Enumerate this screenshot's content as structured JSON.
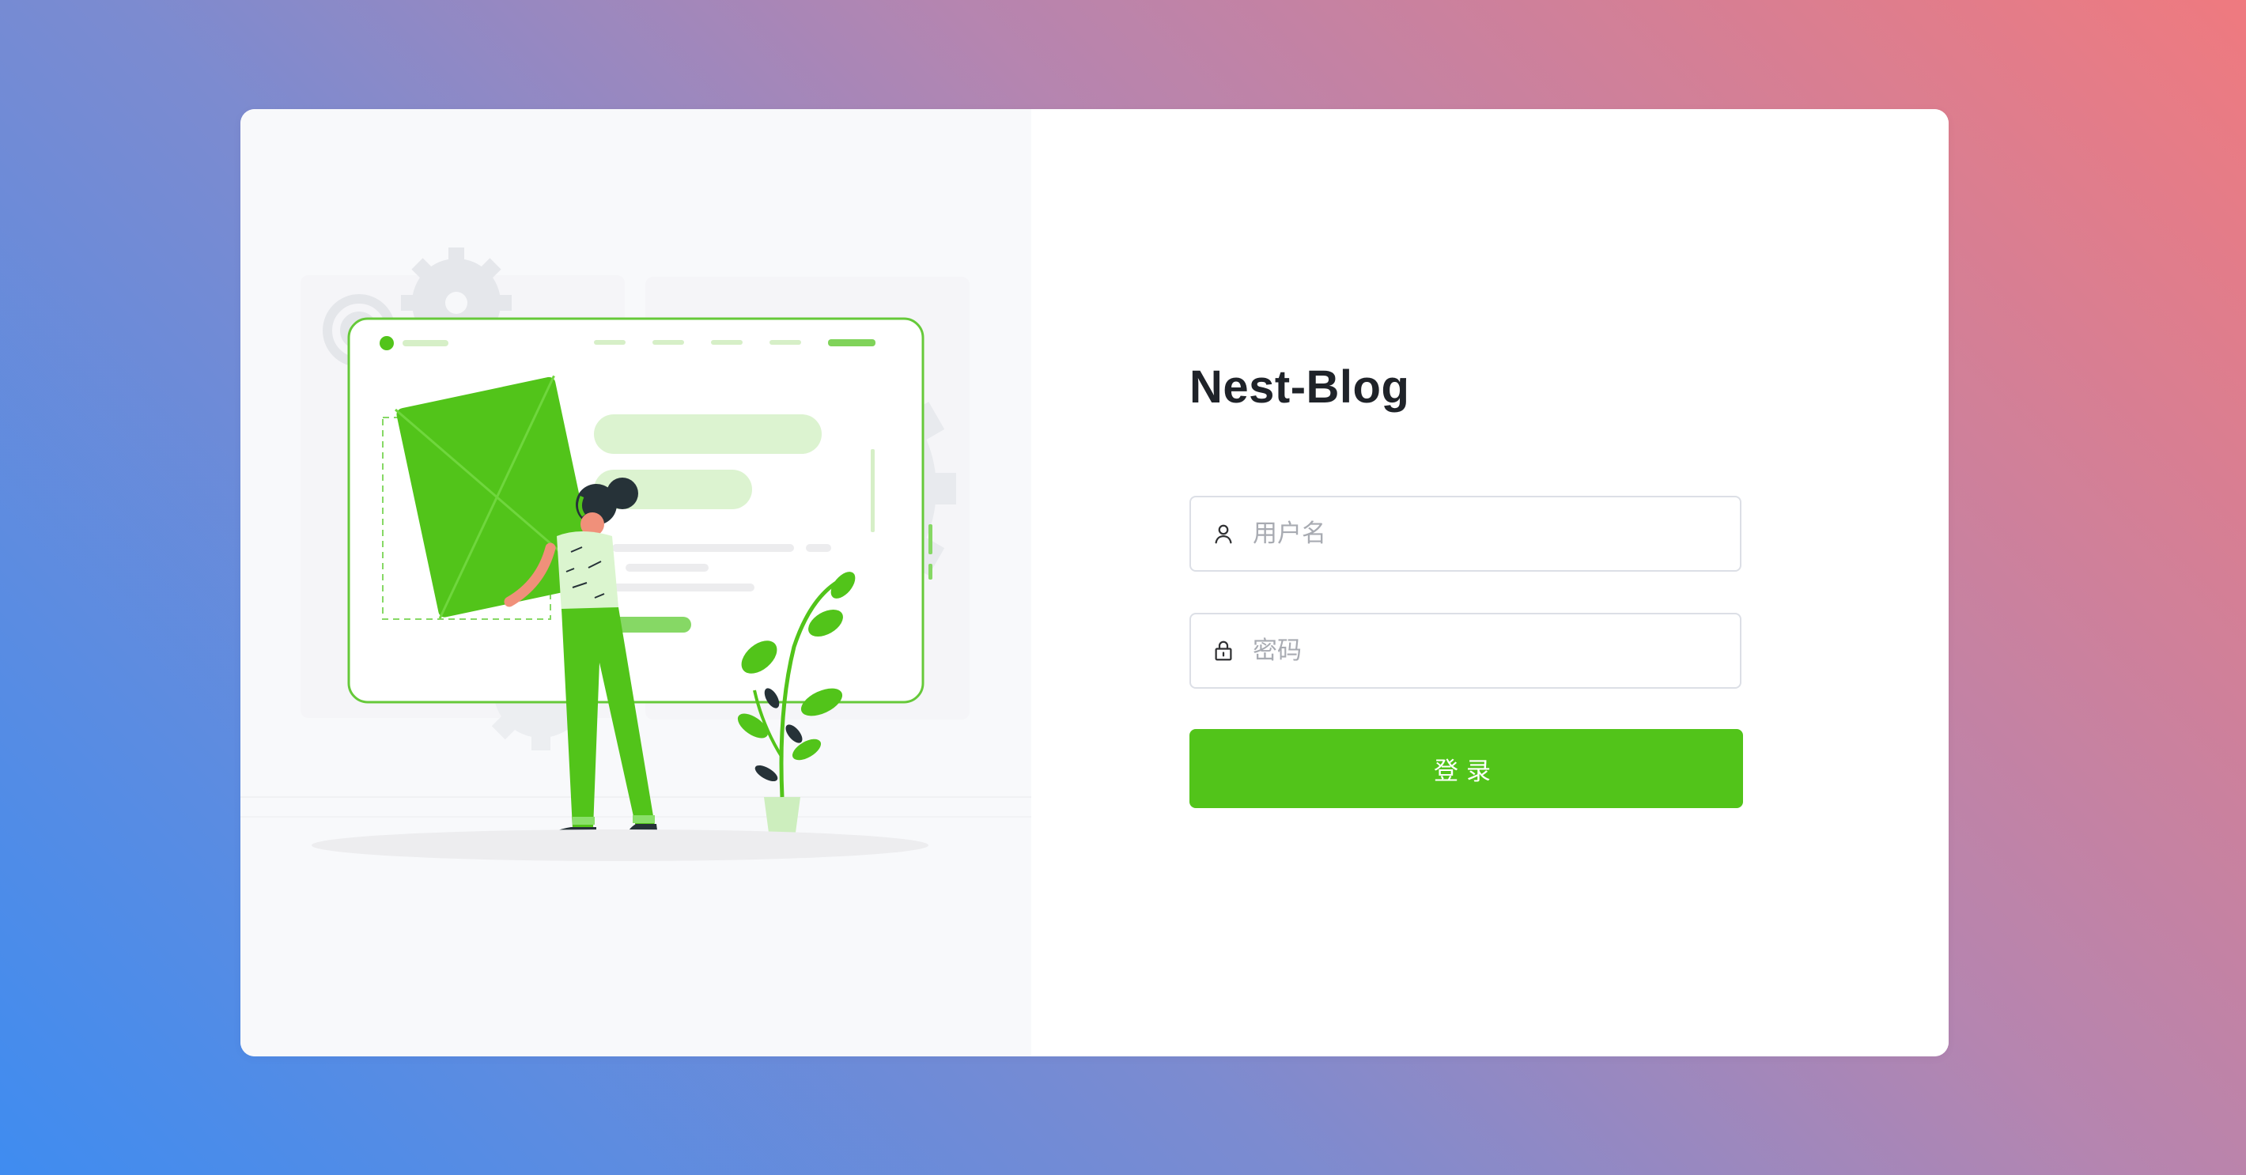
{
  "app": {
    "title": "Nest-Blog"
  },
  "form": {
    "username": {
      "placeholder": "用户名",
      "value": "",
      "icon": "user-icon"
    },
    "password": {
      "placeholder": "密码",
      "value": "",
      "icon": "lock-icon"
    },
    "submit_label": "登录"
  },
  "colors": {
    "accent": "#52c41a",
    "title": "#1f2329",
    "gradient_start": "#3f8cf0",
    "gradient_end": "#ef7a7f"
  }
}
